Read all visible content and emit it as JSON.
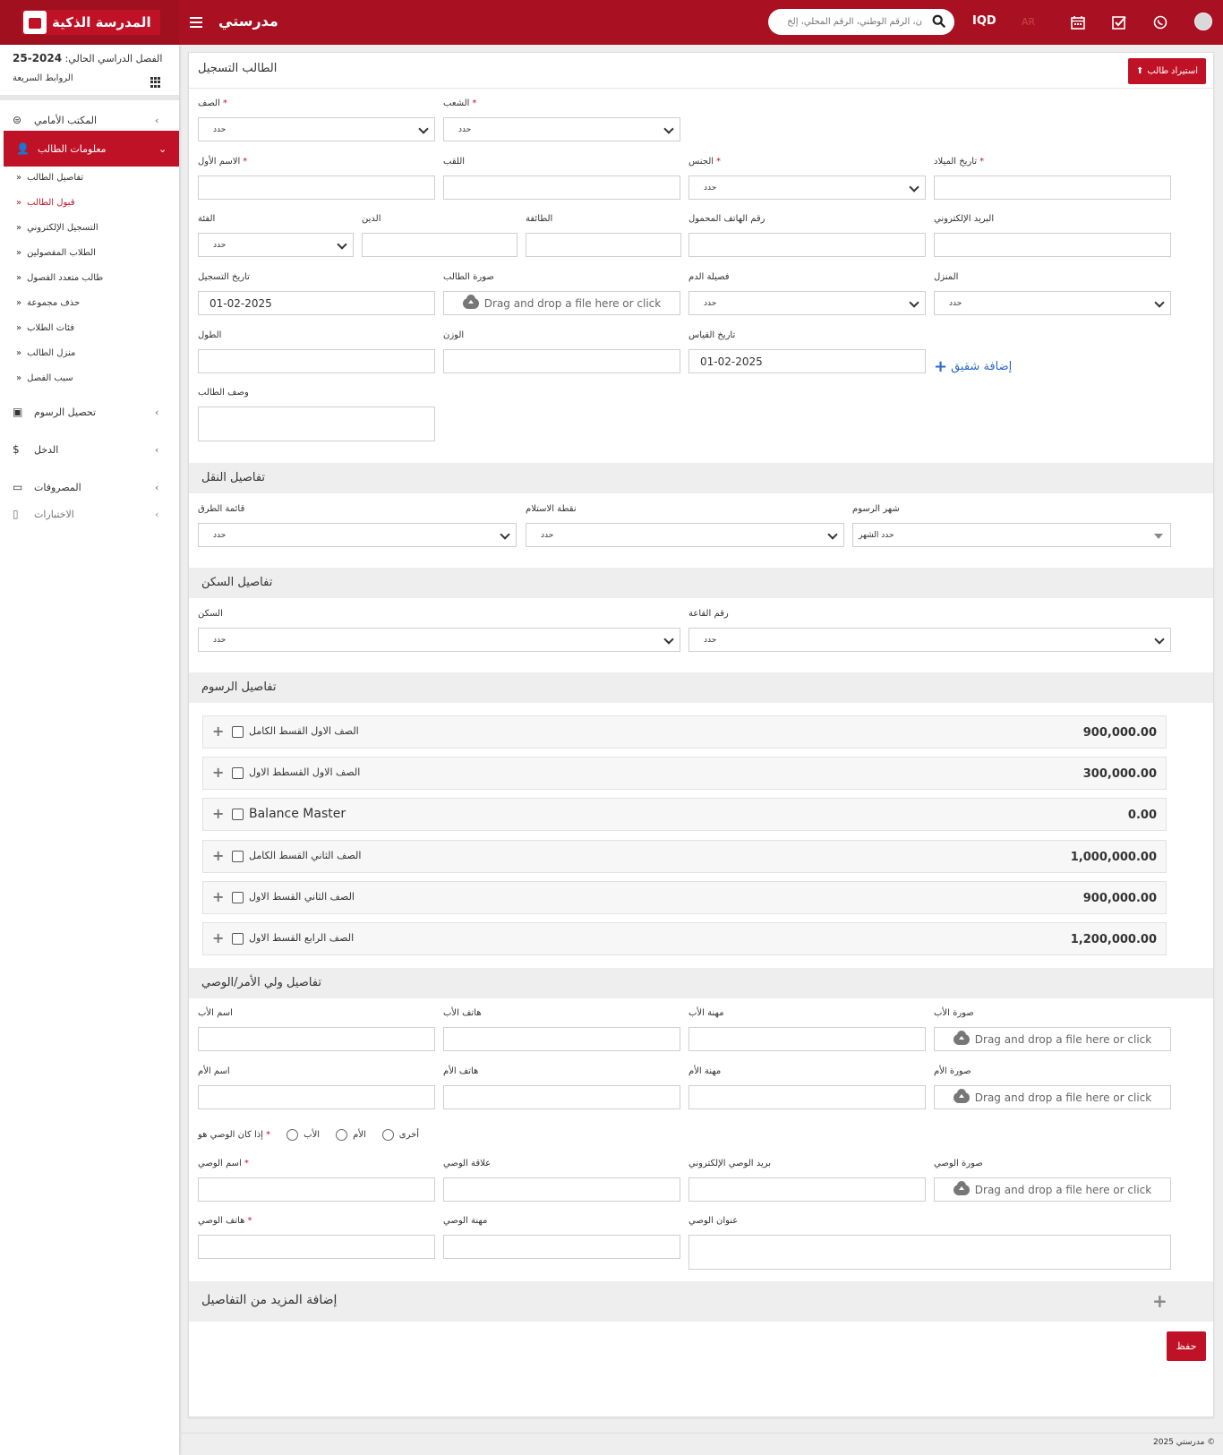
{
  "brand": {
    "name": "المدرسة الذكية"
  },
  "header": {
    "app_title": "مدرستي",
    "search_placeholder": "ن، الرقم الوطني، الرقم المحلي، إلخ",
    "currency": "IQD",
    "language": "AR",
    "icons": [
      "search-icon",
      "calendar-icon",
      "checkbox-icon",
      "whatsapp-icon",
      "avatar-icon"
    ]
  },
  "sidebar": {
    "semester_label": "الفصل الدراسي الحالي:",
    "semester_value": "2024-25",
    "quick_links": "الروابط السريعة",
    "menu": [
      {
        "label": "المكتب الأمامي",
        "icon": "front-office-icon"
      },
      {
        "label": "معلومات الطالب",
        "icon": "user-plus-icon"
      },
      {
        "label": "تحصيل الرسوم",
        "icon": "money-icon"
      },
      {
        "label": "الدخل",
        "icon": "dollar-icon"
      },
      {
        "label": "المصروفات",
        "icon": "card-icon"
      },
      {
        "label": "الاختبارات",
        "icon": "map-icon"
      }
    ],
    "submenu": [
      "تفاصيل الطالب",
      "قبول الطالب",
      "التسجيل الإلكتروني",
      "الطلاب المفصولين",
      "طالب متعدد الفصول",
      "حذف مجموعة",
      "فئات الطلاب",
      "منزل الطالب",
      "سبب الفصل"
    ]
  },
  "main": {
    "title": "الطالب التسجيل",
    "import_button": "استيراد طالب",
    "select_placeholder": "حدد",
    "month_placeholder": "حدد الشهر",
    "drop_text": "Drag and drop a file here or click",
    "labels": {
      "class": "الصف",
      "section": "الشعب",
      "first_name": "الاسم الأول",
      "surname": "اللقب",
      "gender": "الجنس",
      "dob": "تاريخ الميلاد",
      "category": "الفئة",
      "religion": "الدين",
      "caste": "الطائفة",
      "mobile": "رقم الهاتف المحمول",
      "email": "البريد الإلكتروني",
      "admission_date": "تاريخ التسجيل",
      "photo": "صورة الطالب",
      "blood_group": "فصيلة الدم",
      "house": "المنزل",
      "height": "الطول",
      "weight": "الوزن",
      "measure_date": "تاريخ القياس",
      "description": "وصف الطالب"
    },
    "admission_date_value": "01-02-2025",
    "measure_date_value": "01-02-2025",
    "add_sibling": "إضافة شقيق",
    "transport": {
      "title": "تفاصيل النقل",
      "route": "قائمة الطرق",
      "pickup": "نقطة الاستلام",
      "fees_month": "شهر الرسوم"
    },
    "hostel": {
      "title": "تفاصيل السكن",
      "hostel": "السكن",
      "room": "رقم القاعة"
    },
    "fees": {
      "title": "تفاصيل الرسوم",
      "rows": [
        {
          "name": "الصف الاول القسط الكامل",
          "amount": "900,000.00"
        },
        {
          "name": "الصف الاول القسطط الاول",
          "amount": "300,000.00"
        },
        {
          "name": "Balance Master",
          "amount": "0.00"
        },
        {
          "name": "الصف الثاني القسط الكامل",
          "amount": "1,000,000.00"
        },
        {
          "name": "الصف الثاني القسط الاول",
          "amount": "900,000.00"
        },
        {
          "name": "الصف الرابع القسط الاول",
          "amount": "1,200,000.00"
        }
      ]
    },
    "guardian": {
      "title": "تفاصيل ولي الأمر/الوصي",
      "father_name": "اسم الأب",
      "father_phone": "هاتف الأب",
      "father_job": "مهنة الأب",
      "father_photo": "صورة الأب",
      "mother_name": "اسم الأم",
      "mother_phone": "هاتف الأم",
      "mother_job": "مهنة الأم",
      "mother_photo": "صورة الأم",
      "guardian_is": "إذا كان الوصي هو",
      "opt_father": "الأب",
      "opt_mother": "الأم",
      "opt_other": "أخرى",
      "guardian_name": "اسم الوصي",
      "guardian_relation": "علاقة الوصي",
      "guardian_email": "بريد الوصي الإلكتروني",
      "guardian_photo": "صورة الوصي",
      "guardian_phone": "هاتف الوصي",
      "guardian_job": "مهنة الوصي",
      "guardian_address": "عنوان الوصي"
    },
    "more_details": "إضافة المزيد من التفاصيل",
    "save": "حفظ"
  },
  "footer": "مدرستي 2025 ©"
}
